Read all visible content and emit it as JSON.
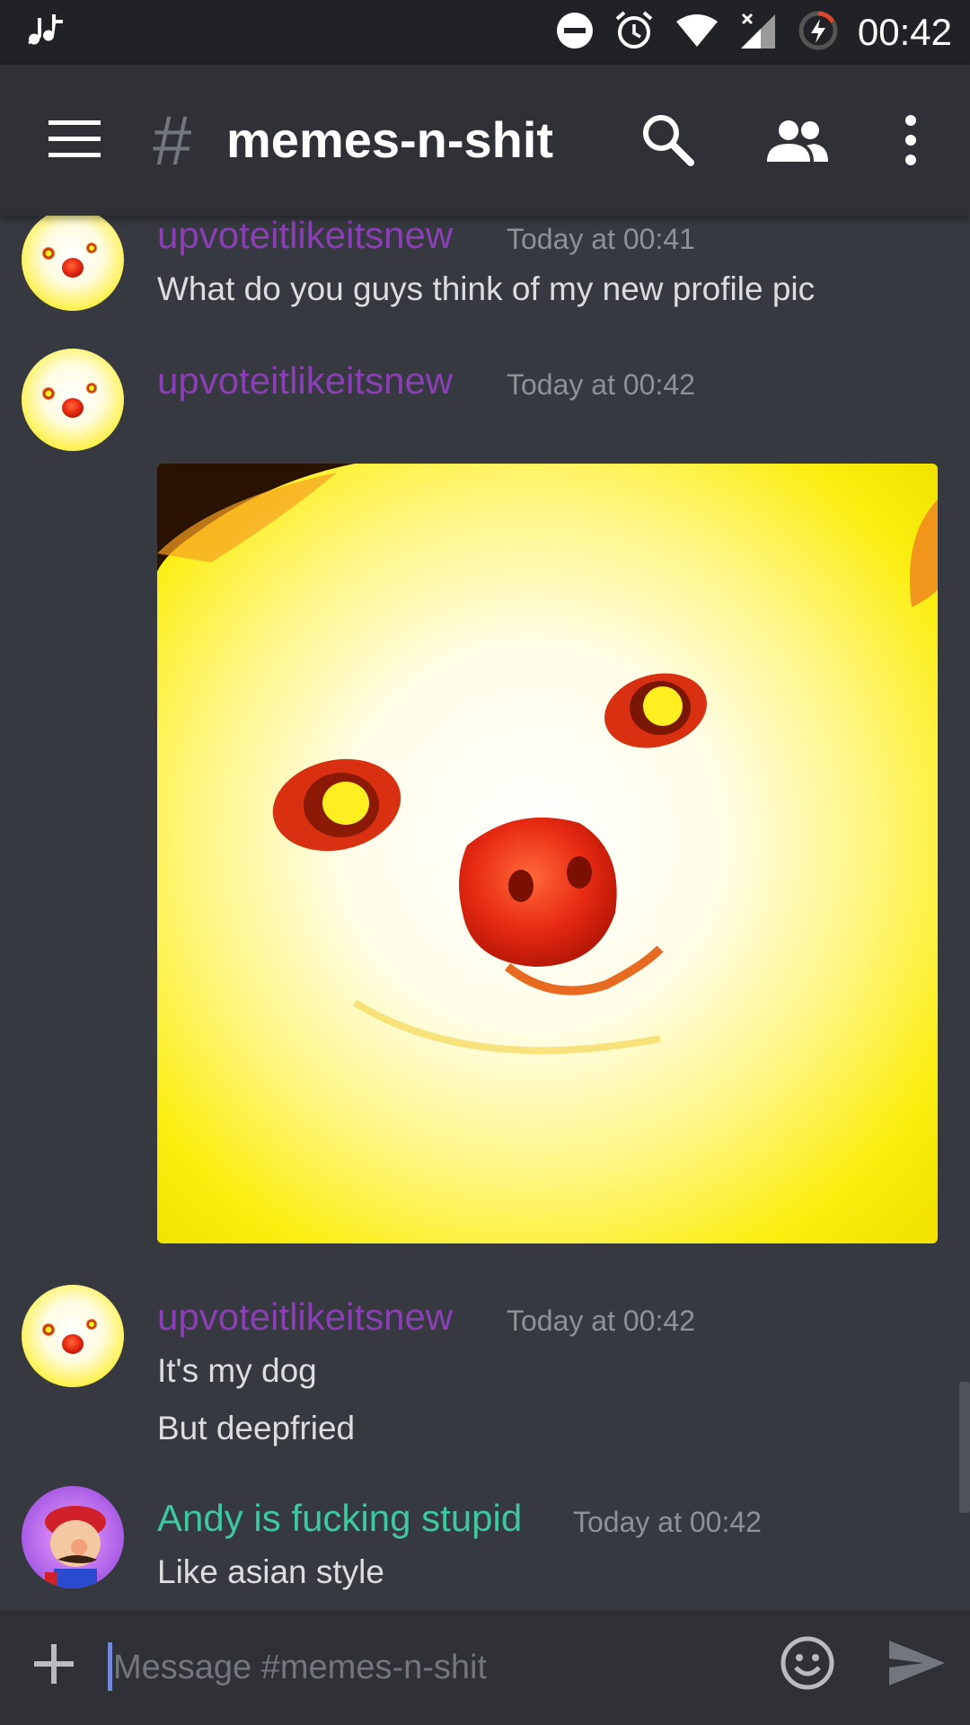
{
  "status_bar": {
    "time": "00:42"
  },
  "header": {
    "channel_hash": "#",
    "channel_name": "memes-n-shit"
  },
  "colors": {
    "user_purple": "#8a3fb4",
    "user_green": "#3ec8a0",
    "background": "#36393f",
    "header": "#2f3136"
  },
  "messages": [
    {
      "author": "upvoteitlikeitsnew",
      "time": "Today at 00:41",
      "lines": [
        "What do you guys think of my new profile pic"
      ]
    },
    {
      "author": "upvoteitlikeitsnew",
      "time": "Today at 00:42",
      "attachment": "deep-fried dog image"
    },
    {
      "author": "upvoteitlikeitsnew",
      "time": "Today at 00:42",
      "lines": [
        "It's my dog",
        "But deepfried"
      ]
    },
    {
      "author": "Andy is fucking stupid",
      "time": "Today at 00:42",
      "lines": [
        "Like asian style"
      ]
    }
  ],
  "composer": {
    "placeholder": "Message #memes-n-shit"
  },
  "icons": [
    "music-note-icon",
    "dnd-icon",
    "alarm-icon",
    "wifi-icon",
    "signal-icon",
    "battery-icon",
    "menu-icon",
    "search-icon",
    "members-icon",
    "more-icon",
    "plus-icon",
    "emoji-icon",
    "send-icon"
  ]
}
